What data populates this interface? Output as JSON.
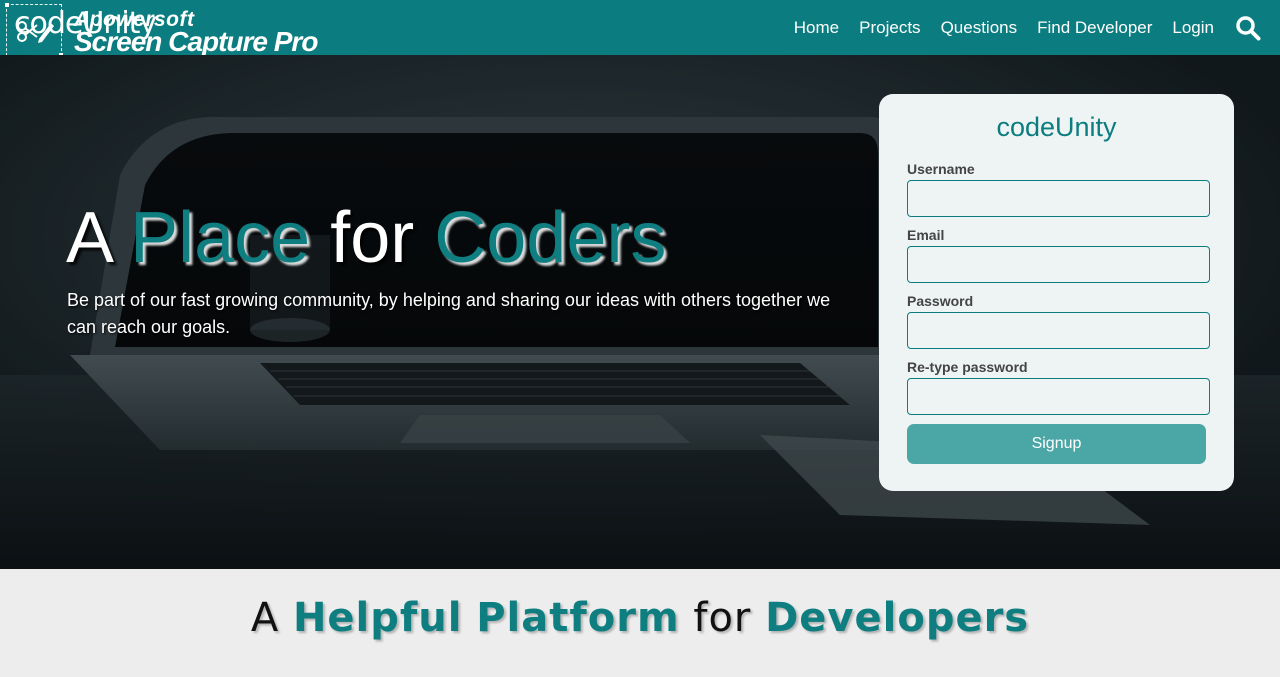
{
  "nav": {
    "brand": "codeUnity",
    "watermark_line1": "Apowersoft",
    "watermark_line2": "Screen Capture Pro",
    "links": [
      "Home",
      "Projects",
      "Questions",
      "Find Developer",
      "Login"
    ],
    "search_icon": "search-icon"
  },
  "hero": {
    "title_a": "A",
    "title_place": "Place",
    "title_for": "for",
    "title_coders": "Coders",
    "subtitle": "Be part of our fast growing community, by helping and sharing our ideas with others together we can reach our goals."
  },
  "signup": {
    "title": "codeUnity",
    "username_label": "Username",
    "username_value": "",
    "email_label": "Email",
    "email_value": "",
    "password_label": "Password",
    "password_value": "",
    "retype_label": "Re-type password",
    "retype_value": "",
    "button_label": "Signup"
  },
  "section": {
    "title_a": "A",
    "title_helpful": "Helpful",
    "title_platform": "Platform",
    "title_for": "for",
    "title_developers": "Developers"
  },
  "colors": {
    "brand": "#0b7d80",
    "accent": "#0e7e80",
    "button": "#4ba6a6",
    "card_bg": "#eef4f4"
  }
}
